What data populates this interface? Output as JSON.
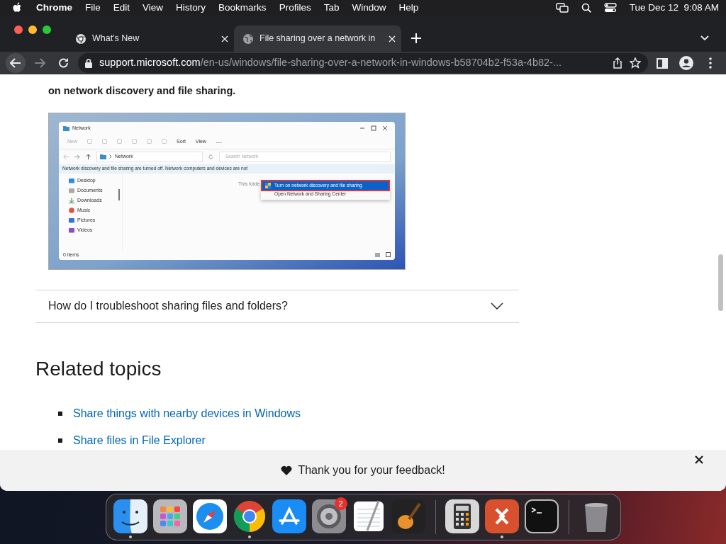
{
  "menubar": {
    "app": "Chrome",
    "menus": [
      "File",
      "Edit",
      "View",
      "History",
      "Bookmarks",
      "Profiles",
      "Tab",
      "Window",
      "Help"
    ],
    "clock": "Tue Dec 12  9:08 AM"
  },
  "tabs": [
    {
      "title": "What's New",
      "selected": false
    },
    {
      "title": "File sharing over a network in",
      "selected": true
    }
  ],
  "address": {
    "domain": "support.microsoft.com",
    "path": "/en-us/windows/file-sharing-over-a-network-in-windows-b58704b2-f53a-4b82-..."
  },
  "article": {
    "bold_line": "on network discovery and file sharing.",
    "screenshot": {
      "title": "Network",
      "toolbar": [
        "New",
        "Sort",
        "View",
        "..."
      ],
      "location": "Network",
      "search_placeholder": "Search Network",
      "banner": "Network discovery and file sharing are turned off. Network computers and devices are not",
      "menu": [
        {
          "label": "Turn on network discovery and file sharing",
          "selected": true
        },
        {
          "label": "Open Network and Sharing Center",
          "selected": false
        }
      ],
      "sidebar": [
        {
          "label": "Desktop",
          "kind": "desktop"
        },
        {
          "label": "Documents",
          "kind": "documents"
        },
        {
          "label": "Downloads",
          "kind": "downloads"
        },
        {
          "label": "Music",
          "kind": "music"
        },
        {
          "label": "Pictures",
          "kind": "pictures"
        },
        {
          "label": "Videos",
          "kind": "videos"
        }
      ],
      "empty_text": "This folde",
      "status": "0 items"
    },
    "accordion": {
      "title": "How do I troubleshoot sharing files and folders?",
      "expanded": false
    },
    "heading": "Related topics",
    "links": [
      "Share things with nearby devices in Windows",
      "Share files in File Explorer"
    ]
  },
  "feedback": {
    "message": "Thank you for your feedback!"
  },
  "dock": {
    "groups": [
      [
        {
          "kind": "finder",
          "running": true
        },
        {
          "kind": "launchpad",
          "running": false
        },
        {
          "kind": "safari",
          "running": false
        },
        {
          "kind": "chrome",
          "running": true
        },
        {
          "kind": "appstore",
          "running": false
        },
        {
          "kind": "settings",
          "running": false,
          "badge": "2"
        },
        {
          "kind": "textedit",
          "running": false
        },
        {
          "kind": "garageband",
          "running": false
        }
      ],
      [
        {
          "kind": "calculator",
          "running": false
        },
        {
          "kind": "remote",
          "running": true
        },
        {
          "kind": "terminal",
          "running": false
        }
      ],
      [
        {
          "kind": "trash",
          "running": false
        }
      ]
    ]
  }
}
